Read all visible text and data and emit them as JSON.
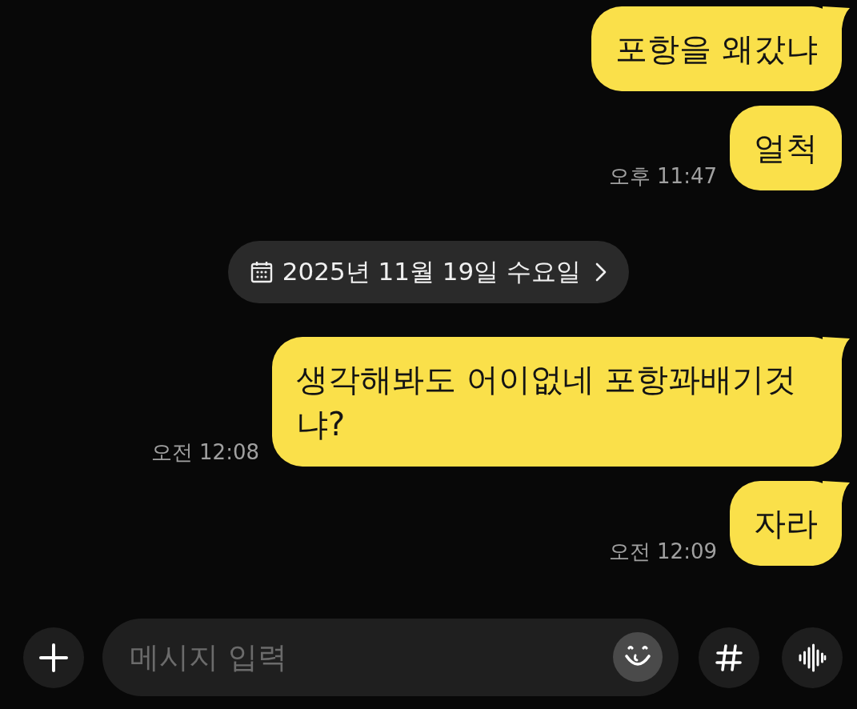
{
  "messages": [
    {
      "kind": "message",
      "text": "포항을 왜갔냐",
      "tail": true
    },
    {
      "kind": "message",
      "text": "얼척",
      "tail": false,
      "time": "오후 11:47"
    },
    {
      "kind": "date",
      "text": "2025년 11월 19일 수요일"
    },
    {
      "kind": "message",
      "text": "생각해봐도 어이없네 포항꽈배기것냐?",
      "tail": true,
      "time": "오전 12:08"
    },
    {
      "kind": "message",
      "text": "자라",
      "tail": true,
      "time": "오전 12:09"
    }
  ],
  "composer": {
    "placeholder": "메시지 입력"
  }
}
